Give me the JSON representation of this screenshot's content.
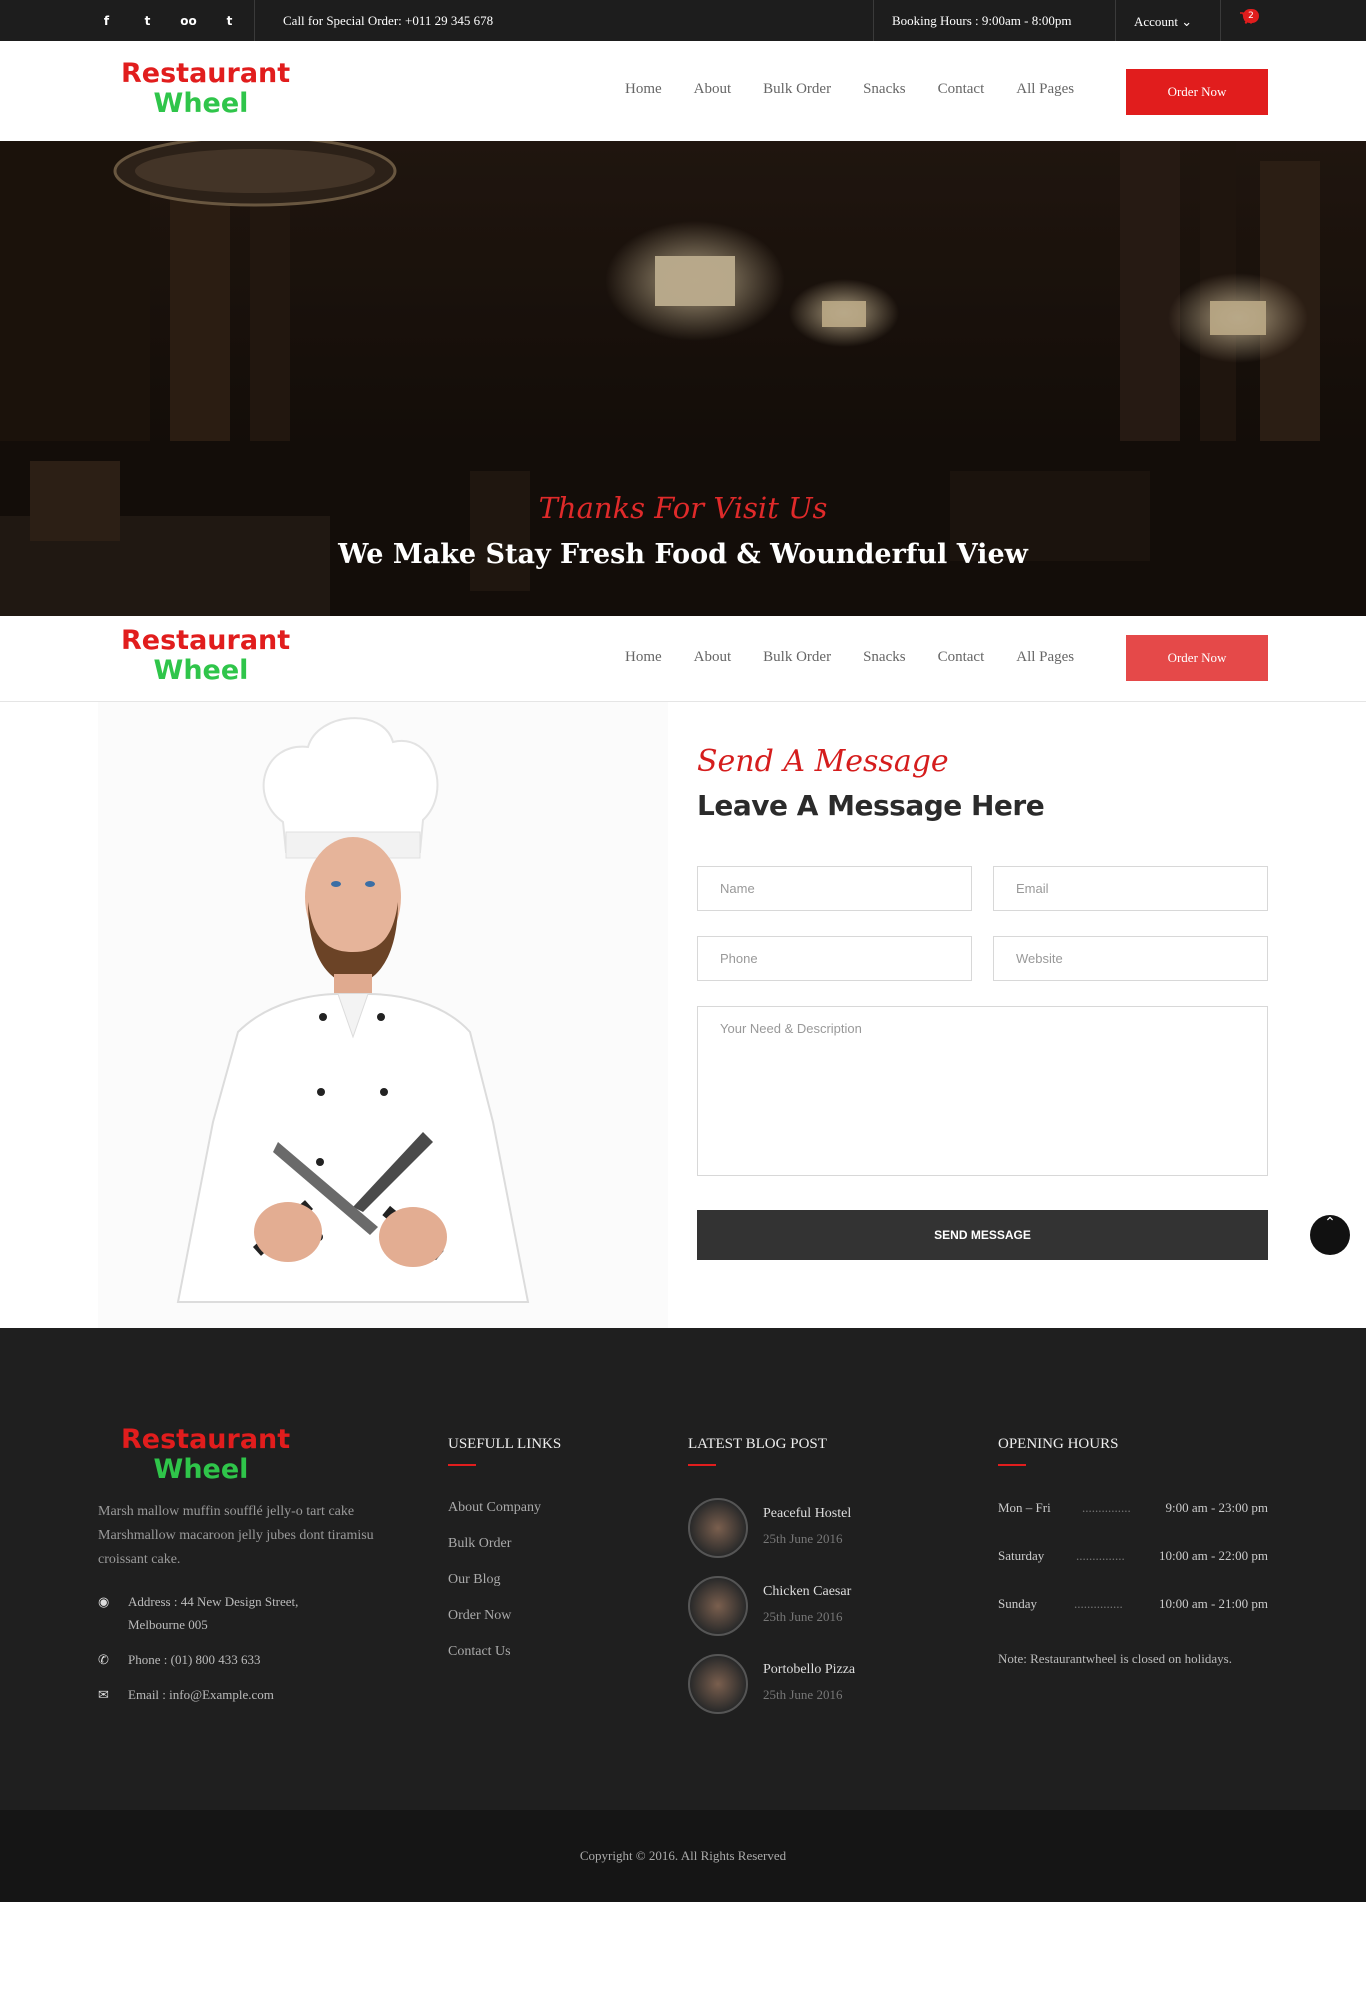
{
  "topbar": {
    "social_icons": [
      "facebook-icon",
      "twitter-icon",
      "tripadvisor-icon",
      "tumblr-icon"
    ],
    "social_glyphs": [
      "f",
      "t",
      "oo",
      "t"
    ],
    "call_text": "Call for Special Order: +011 29 345 678",
    "booking_hours": "Booking Hours : 9:00am - 8:00pm",
    "account_label": "Account ⌄",
    "cart_count": "2"
  },
  "logo": {
    "line1": "Restaurant",
    "line2": "Wheel"
  },
  "nav": {
    "items": [
      "Home",
      "About",
      "Bulk Order",
      "Snacks",
      "Contact",
      "All Pages"
    ],
    "order_button": "Order Now"
  },
  "hero": {
    "script": "Thanks For Visit Us",
    "headline": "We Make Stay Fresh Food & Wounderful View"
  },
  "contact": {
    "script": "Send A Message",
    "title": "Leave A Message Here",
    "placeholders": {
      "name": "Name",
      "email": "Email",
      "phone": "Phone",
      "website": "Website",
      "description": "Your Need & Description"
    },
    "send_button": "SEND MESSAGE"
  },
  "footer": {
    "description": "Marsh mallow muffin soufflé jelly-o tart cake Marshmallow macaroon jelly jubes dont tiramisu croissant cake.",
    "address_line1": "Address : 44 New Design Street,",
    "address_line2": "Melbourne 005",
    "phone": "Phone : (01) 800 433 633",
    "email": "Email : info@Example.com",
    "links_heading": "USEFULL LINKS",
    "links": [
      "About Company",
      "Bulk Order",
      "Our Blog",
      "Order Now",
      "Contact Us"
    ],
    "blog_heading": "LATEST BLOG POST",
    "posts": [
      {
        "title": "Peaceful Hostel",
        "date": "25th June 2016"
      },
      {
        "title": "Chicken Caesar",
        "date": "25th June 2016"
      },
      {
        "title": "Portobello Pizza",
        "date": "25th June 2016"
      }
    ],
    "hours_heading": "OPENING HOURS",
    "hours": [
      {
        "day": "Mon – Fri",
        "dots": "...............",
        "time": "9:00 am - 23:00 pm"
      },
      {
        "day": "Saturday",
        "dots": "...............",
        "time": "10:00 am - 22:00 pm"
      },
      {
        "day": "Sunday",
        "dots": "...............",
        "time": "10:00 am - 21:00 pm"
      }
    ],
    "note": "Note: Restaurantwheel is closed on holidays.",
    "copyright": "Copyright © 2016. All Rights Reserved"
  },
  "colors": {
    "accent": "#e11d1d",
    "logo_green": "#2fc54a",
    "dark": "#1f1f1f"
  }
}
